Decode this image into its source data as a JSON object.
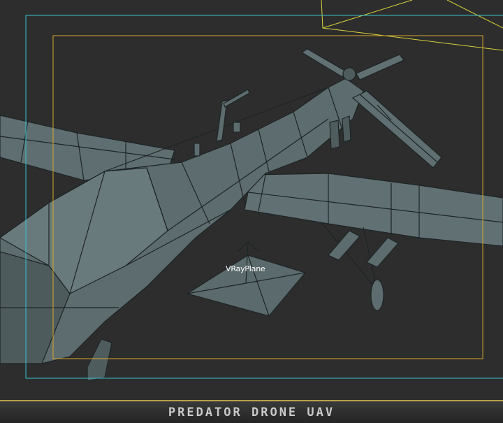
{
  "viewport": {
    "object_label": "VRayPlane",
    "mesh_color": "#5d6c6e",
    "wire_color": "#1d2426",
    "safe_frame_outer_color": "#35c2d0",
    "safe_frame_inner_color": "#d8a72a",
    "camera_color": "#d8d23a"
  },
  "footer": {
    "title": "PREDATOR DRONE UAV"
  }
}
